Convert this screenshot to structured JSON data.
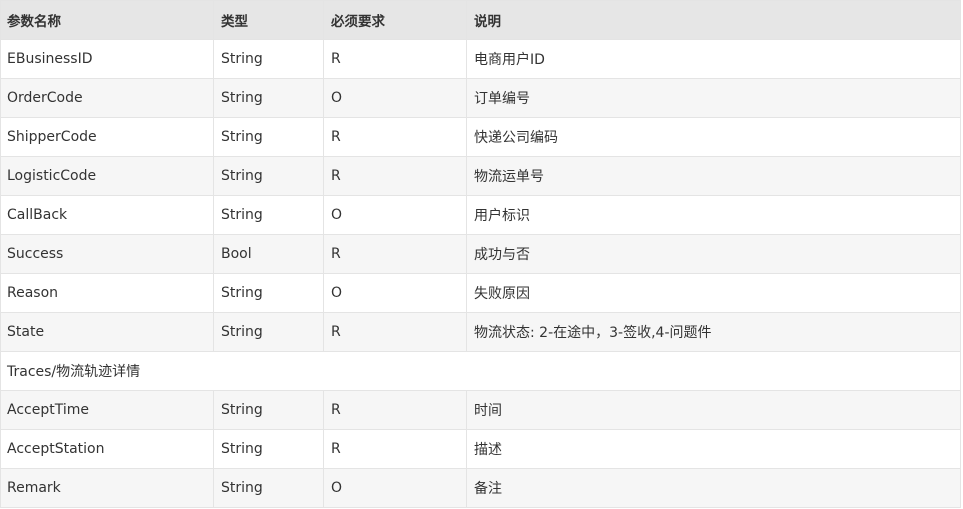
{
  "table": {
    "headers": [
      "参数名称",
      "类型",
      "必须要求",
      "说明"
    ],
    "rows": [
      [
        "EBusinessID",
        "String",
        "R",
        "电商用户ID"
      ],
      [
        "OrderCode",
        "String",
        "O",
        "订单编号"
      ],
      [
        "ShipperCode",
        "String",
        "R",
        "快递公司编码"
      ],
      [
        "LogisticCode",
        "String",
        "R",
        "物流运单号"
      ],
      [
        "CallBack",
        "String",
        "O",
        "用户标识"
      ],
      [
        "Success",
        "Bool",
        "R",
        "成功与否"
      ],
      [
        "Reason",
        "String",
        "O",
        "失败原因"
      ],
      [
        "State",
        "String",
        "R",
        "物流状态: 2-在途中，3-签收,4-问题件"
      ]
    ],
    "section_title": "Traces/物流轨迹详情",
    "section_rows": [
      [
        "AcceptTime",
        "String",
        "R",
        "时间"
      ],
      [
        "AcceptStation",
        "String",
        "R",
        "描述"
      ],
      [
        "Remark",
        "String",
        "O",
        "备注"
      ]
    ]
  }
}
